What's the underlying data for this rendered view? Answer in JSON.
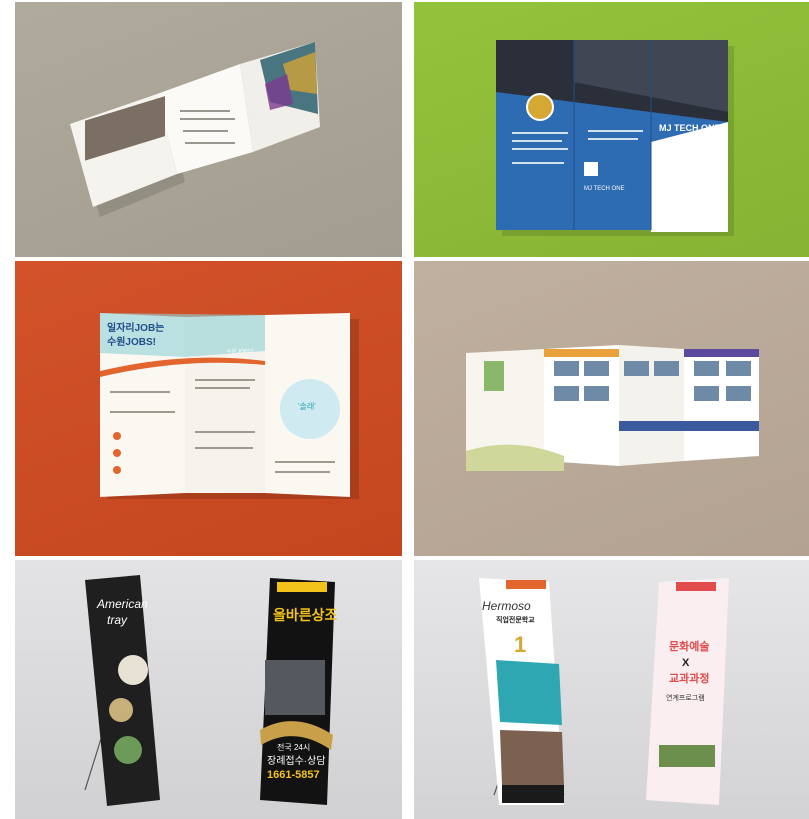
{
  "tiles": [
    {
      "name": "square-brochure",
      "texts": []
    },
    {
      "name": "mj-tech-one-trifold",
      "texts": [
        "MJ TECH ONE",
        "MJ TECH ONE"
      ]
    },
    {
      "name": "jobs-trifold",
      "texts": [
        "일자리JOB는",
        "수원JOBS!",
        "수원 JOBS?",
        "'솔래'"
      ]
    },
    {
      "name": "tour-brochure",
      "texts": []
    },
    {
      "name": "xbanner-pair-left",
      "texts": [
        "American",
        "tray",
        "올바른상조",
        "전국 24시",
        "장례접수·상담",
        "1661-5857"
      ]
    },
    {
      "name": "xbanner-pair-right",
      "texts": [
        "Hermoso",
        "직업전문학교",
        "1",
        "문화예술",
        "X",
        "교과과정",
        "연계프로그램"
      ]
    }
  ],
  "colors": {
    "mj_blue": "#2d6bb3",
    "jobs_teal": "#2fa7b3",
    "jobs_orange": "#e2652d",
    "banner_gold": "#f3c31a",
    "banner_red": "#e24c4c"
  }
}
